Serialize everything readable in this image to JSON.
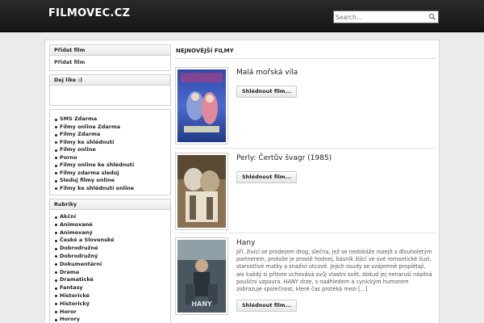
{
  "site": {
    "logo": "FILMOVEC.CZ"
  },
  "search": {
    "placeholder": "Search..."
  },
  "sidebar": {
    "add_film": {
      "title": "Přidat film",
      "link": "Přidat film"
    },
    "like": {
      "title": "Dej like :)"
    },
    "links": [
      "SMS Zdarma",
      "Filmy online Zdarma",
      "Filmy Zdarma",
      "Filmy ke shlédnutí",
      "Filmy online",
      "Porno",
      "Filmy online ke shlédnutí",
      "Filmy zdarma sleduj",
      "Sleduj filmy online",
      "Filmy ke shlédnutí online"
    ],
    "categories": {
      "title": "Rubriky",
      "items": [
        "Akční",
        "Animované",
        "Animovaný",
        "České a Slovenské",
        "Dobrodružné",
        "Dobrodružný",
        "Dokumentární",
        "Drama",
        "Dramatické",
        "Fantasy",
        "Historické",
        "Historický",
        "Horor",
        "Horory"
      ]
    }
  },
  "main": {
    "section_title": "NEJNOVĚJŠÍ FILMY",
    "button_label": "Shlédnout film...",
    "films": [
      {
        "title": "Malá mořská víla",
        "description": ""
      },
      {
        "title": "Perly: Čertův švagr (1985)",
        "description": ""
      },
      {
        "title": "Hany",
        "description": "Jiří, živící se prodejem drog, slečna, jež se nedokáže rozejít s dlouholetým partnerem, protože je prostě hodnej, básník žijící ve své romantické iluzi, starostlivé matky a snaživí otcové. Jejich osudy se vzájemně proplétají, ale každý si přitom uchovává svůj vlastní svět, dokud jej nenaruší násilná pouliční vzpoura. HANY drze, s nadhledem a cynickým humorem zobrazuje společnost, které čas protéká mezi [...]"
      }
    ]
  },
  "colors": {
    "header_bg": "#1e1e1e",
    "page_bg": "#ebebeb",
    "panel_bg": "#ffffff"
  }
}
